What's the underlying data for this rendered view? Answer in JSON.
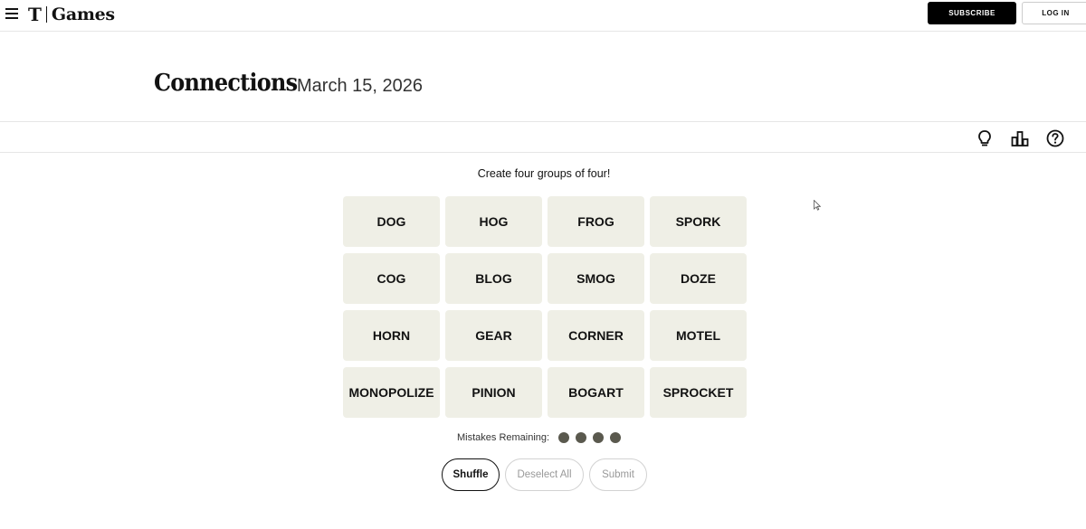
{
  "header": {
    "logo_mark": "T",
    "logo_text": "Games",
    "subscribe_label": "SUBSCRIBE",
    "login_label": "LOG IN"
  },
  "title": {
    "game_name": "Connections",
    "date": "March 15, 2026"
  },
  "toolbar": {
    "icons": [
      "lightbulb-icon",
      "bar-chart-icon",
      "help-icon"
    ]
  },
  "game": {
    "instructions": "Create four groups of four!",
    "tiles": [
      "DOG",
      "HOG",
      "FROG",
      "SPORK",
      "COG",
      "BLOG",
      "SMOG",
      "DOZE",
      "HORN",
      "GEAR",
      "CORNER",
      "MOTEL",
      "MONOPOLIZE",
      "PINION",
      "BOGART",
      "SPROCKET"
    ],
    "mistakes_label": "Mistakes Remaining:",
    "mistakes_remaining": 4,
    "tile_color": "#efefe6",
    "dot_color": "#5a594e"
  },
  "actions": {
    "shuffle_label": "Shuffle",
    "deselect_label": "Deselect All",
    "submit_label": "Submit"
  }
}
